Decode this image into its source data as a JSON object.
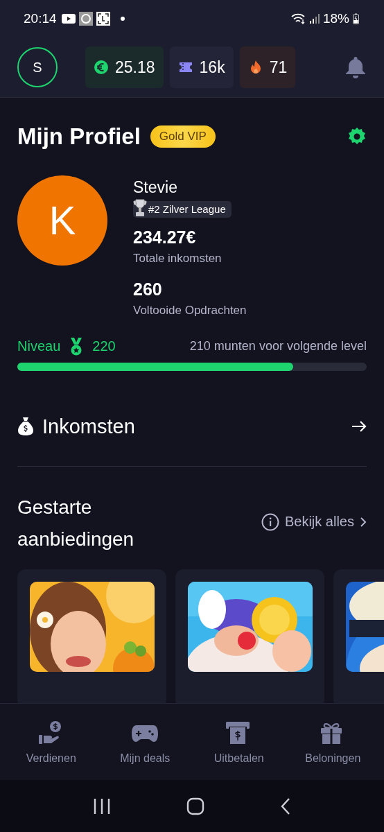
{
  "status_bar": {
    "time": "20:14",
    "battery": "18%"
  },
  "header": {
    "avatar": "S",
    "balances": [
      {
        "kind": "euro",
        "value": "25.18"
      },
      {
        "kind": "ticket",
        "value": "16k"
      },
      {
        "kind": "streak",
        "value": "71"
      }
    ]
  },
  "profile": {
    "title": "Mijn Profiel",
    "badge": "Gold VIP",
    "avatar": "K",
    "name": "Stevie",
    "league": "#2 Zilver League",
    "stats": [
      {
        "value": "234.27€",
        "label": "Totale inkomsten"
      },
      {
        "value": "260",
        "label": "Voltooide Opdrachten"
      }
    ]
  },
  "level": {
    "label": "Niveau",
    "value": "220",
    "hint": "210 munten voor volgende level",
    "level": 0.79
  },
  "earnings": {
    "title": "Inkomsten"
  },
  "offers": {
    "title": "Gestarte aanbiedingen",
    "link": "Bekijk alles"
  },
  "bottom_nav": [
    {
      "kind": "earn",
      "label": "Verdienen"
    },
    {
      "kind": "deals",
      "label": "Mijn deals"
    },
    {
      "kind": "payout",
      "label": "Uitbetalen"
    },
    {
      "kind": "rewards",
      "label": "Beloningen"
    }
  ]
}
